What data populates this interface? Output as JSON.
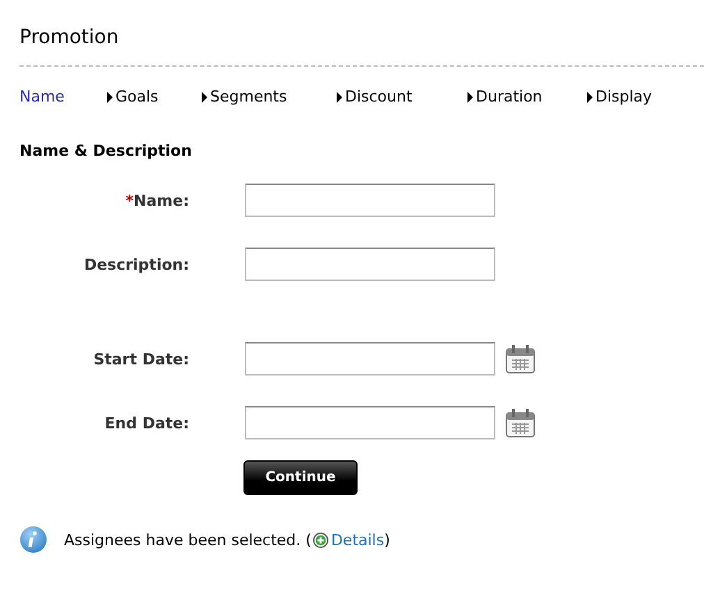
{
  "title": "Promotion",
  "steps": [
    {
      "label": "Name",
      "selected": true
    },
    {
      "label": "Goals",
      "selected": false
    },
    {
      "label": "Segments",
      "selected": false
    },
    {
      "label": "Discount",
      "selected": false
    },
    {
      "label": "Duration",
      "selected": false
    },
    {
      "label": "Display",
      "selected": false
    }
  ],
  "section_title": "Name & Description",
  "fields": [
    {
      "label": "Name:",
      "kind": "text",
      "required": true
    },
    {
      "label": "Description:",
      "kind": "text",
      "required": false
    },
    {
      "label": "Start Date:",
      "kind": "date",
      "required": false
    },
    {
      "label": "End Date:",
      "kind": "date",
      "required": false
    }
  ],
  "required_marker": "*",
  "continue_button": "Continue",
  "notice": {
    "text_before": "Assignees have been selected. (",
    "link": "Details",
    "text_after": ")"
  }
}
